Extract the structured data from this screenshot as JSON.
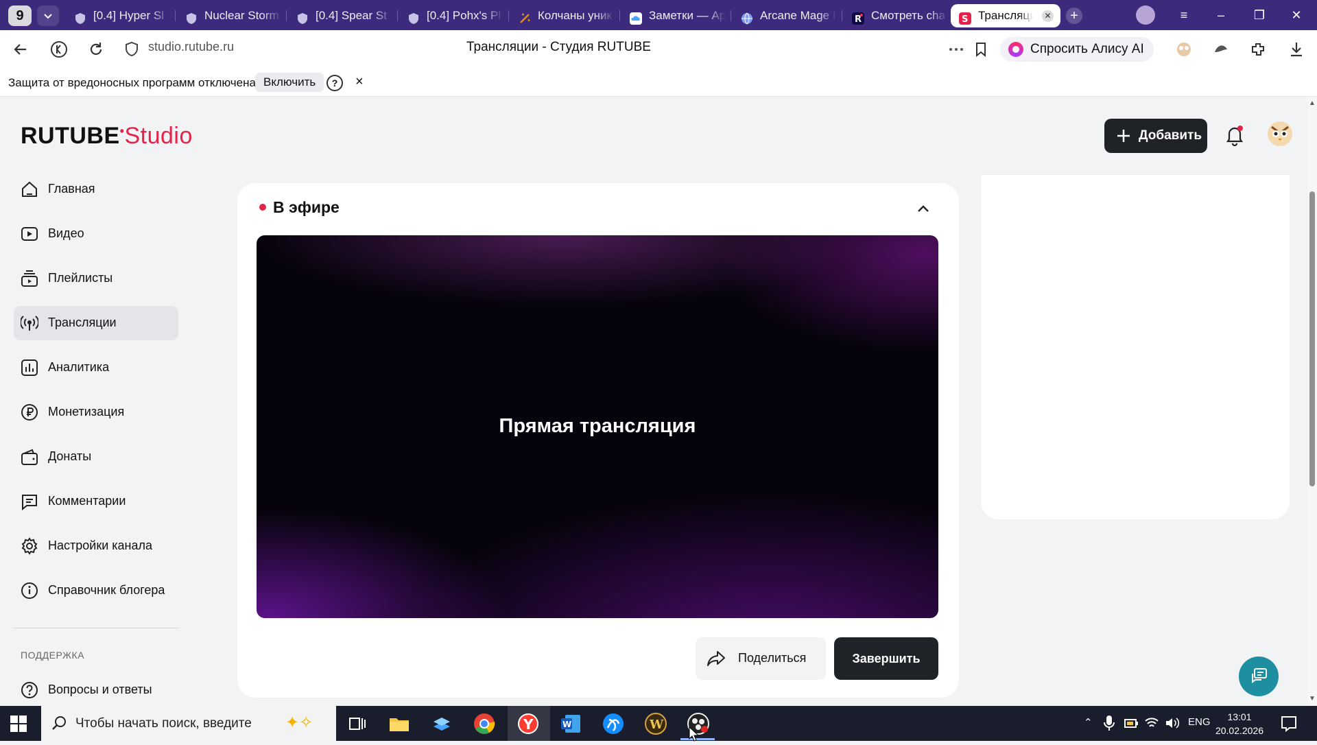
{
  "browser": {
    "tab_count": "9",
    "tabs": [
      {
        "label": "[0.4] Hyper Sl",
        "icon": "shield-icon",
        "color": "#c7c3e6"
      },
      {
        "label": "Nuclear Storm",
        "icon": "shield-icon",
        "color": "#c7c3e6"
      },
      {
        "label": "[0.4] Spear St",
        "icon": "shield-icon",
        "color": "#c7c3e6"
      },
      {
        "label": "[0.4] Pohx's Pl",
        "icon": "shield-icon",
        "color": "#c7c3e6"
      },
      {
        "label": "Колчаны уник",
        "icon": "game-icon",
        "color": "#d98a2b"
      },
      {
        "label": "Заметки — Ар",
        "icon": "cloud-icon",
        "color": "#4aa3ff"
      },
      {
        "label": "Arcane Mage I",
        "icon": "globe-icon",
        "color": "#7f9cf5"
      },
      {
        "label": "Смотреть cha",
        "icon": "rutube-icon",
        "color": "#ff2b55"
      },
      {
        "label": "Трансляции",
        "icon": "studio-icon",
        "color": "#e4234b"
      }
    ],
    "address": {
      "url": "studio.rutube.ru",
      "page_title": "Трансляции - Студия RUTUBE",
      "alice_label": "Спросить Алису AI"
    },
    "protection": {
      "text": "Защита от вредоносных программ отключена",
      "enable_label": "Включить",
      "help_glyph": "?",
      "close_glyph": "×"
    }
  },
  "studio": {
    "logo_word": "RUTUBE",
    "logo_suffix": "Studio",
    "add_label": "Добавить",
    "sidebar": [
      {
        "label": "Главная",
        "icon": "home-icon"
      },
      {
        "label": "Видео",
        "icon": "video-icon"
      },
      {
        "label": "Плейлисты",
        "icon": "playlist-icon"
      },
      {
        "label": "Трансляции",
        "icon": "broadcast-icon",
        "active": true
      },
      {
        "label": "Аналитика",
        "icon": "analytics-icon"
      },
      {
        "label": "Монетизация",
        "icon": "ruble-icon"
      },
      {
        "label": "Донаты",
        "icon": "wallet-icon"
      },
      {
        "label": "Комментарии",
        "icon": "comment-icon"
      },
      {
        "label": "Настройки канала",
        "icon": "gear-icon"
      },
      {
        "label": "Справочник блогера",
        "icon": "info-icon"
      }
    ],
    "support_heading": "ПОДДЕРЖКА",
    "support_items": [
      {
        "label": "Вопросы и ответы",
        "icon": "help-icon"
      }
    ],
    "live": {
      "title": "В эфире",
      "player_text": "Прямая трансляция",
      "share_label": "Поделиться",
      "end_label": "Завершить"
    }
  },
  "taskbar": {
    "search_placeholder": "Чтобы начать поиск, введите",
    "lang": "ENG",
    "time": "13:01",
    "date": "20.02.2026"
  },
  "colors": {
    "brand_red": "#e4234b",
    "tabstrip": "#3c2a7d",
    "dark_button": "#1f2226",
    "chat_button": "#1e8fa0"
  }
}
